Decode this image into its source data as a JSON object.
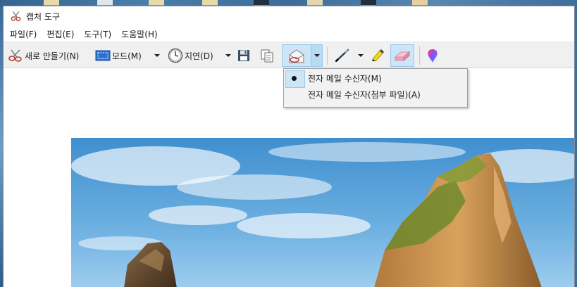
{
  "window": {
    "title": "캡처 도구",
    "app_icon": "scissors-icon"
  },
  "menu": [
    {
      "label": "파일(F)"
    },
    {
      "label": "편집(E)"
    },
    {
      "label": "도구(T)"
    },
    {
      "label": "도움말(H)"
    }
  ],
  "toolbar": {
    "new_label": "새로 만들기(N)",
    "new_icon": "scissors-icon",
    "mode_label": "모드(M)",
    "mode_icon": "rectangle-snip-icon",
    "delay_label": "지연(D)",
    "delay_icon": "clock-icon",
    "save_icon": "save-icon",
    "copy_icon": "copy-icon",
    "email_icon": "email-icon",
    "pen_icon": "pen-icon",
    "highlighter_icon": "highlighter-icon",
    "eraser_icon": "eraser-icon",
    "paint3d_icon": "paint3d-icon"
  },
  "email_menu": {
    "items": [
      {
        "label": "전자 메일 수신자(M)",
        "selected": true
      },
      {
        "label": "전자 메일 수신자(첨부 파일)(A)",
        "selected": false
      }
    ]
  },
  "colors": {
    "accent": "#cde6f7",
    "accent_border": "#99c8ea",
    "toolbar_bg": "#f0f0f0"
  }
}
